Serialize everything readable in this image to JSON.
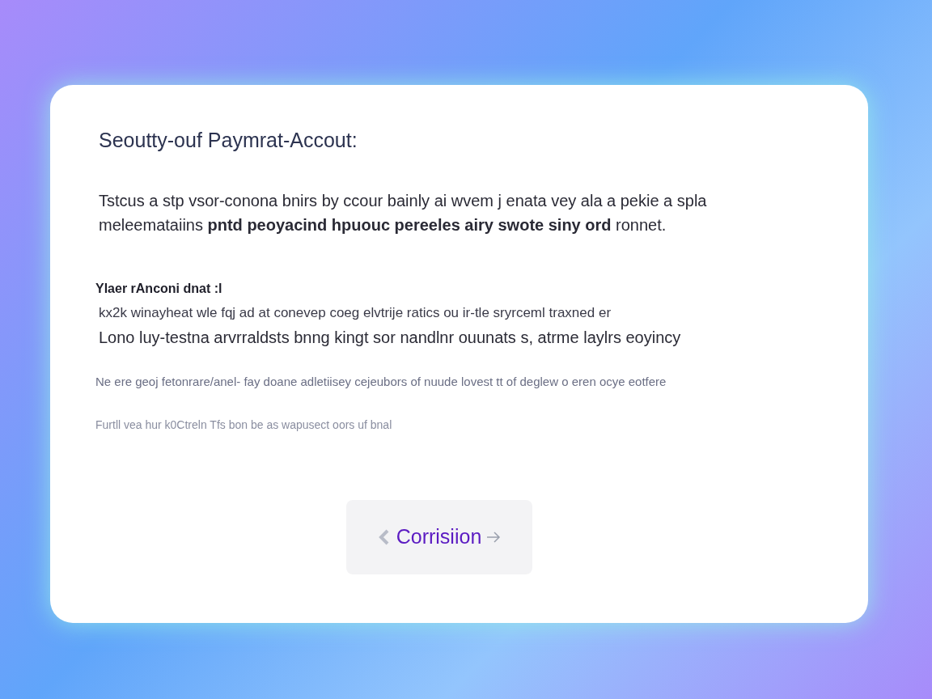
{
  "dialog": {
    "title": "Seoutty-ouf Paymrat-Accout:",
    "intro": "Tstcus a stp vsor-conona bnirs by ccour bainly ai wvem j enata vey ala a pekie a spla meleemataiins **pntd peoyacind hpuouc pereeles airy swote siny ord** ronnet.",
    "section_label": "Ylaer rAnconi dnat :l",
    "detail_lines": [
      "kx2k winayheat wle fqj ad at conevep coeg elvtrije ratics ou ir-tle sryrceml traxned er",
      "Lono luy-testna arvrraldsts bnng kingt sor nandlnr ouunats s, atrme laylrs eoyincy"
    ],
    "notes": [
      "Ne ere geoj fetonrare/anel- fay doane adletiisey cejeubors of nuude lovest tt of deglew o eren ocye eotfere",
      "Furtll vea hur k0Ctreln Tfs bon be as wapusect oors uf bnal"
    ],
    "button": {
      "label": "Corrisiion"
    }
  }
}
